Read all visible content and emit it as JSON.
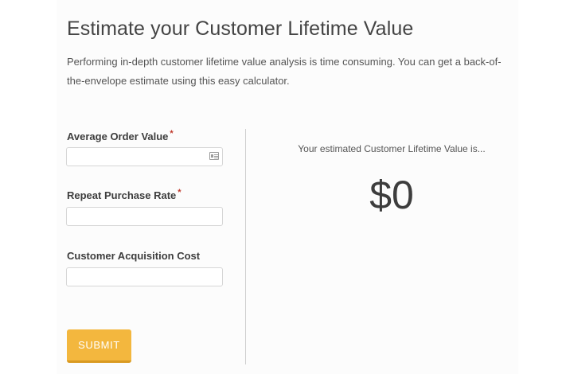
{
  "header": {
    "title": "Estimate your Customer Lifetime Value",
    "intro": "Performing in-depth customer lifetime value analysis is time consuming. You can get a back-of-the-envelope estimate using this easy calculator."
  },
  "form": {
    "fields": [
      {
        "label": "Average Order Value",
        "required": "*",
        "value": "",
        "icon": "contact-card-icon"
      },
      {
        "label": "Repeat Purchase Rate",
        "required": "*",
        "value": ""
      },
      {
        "label": "Customer Acquisition Cost",
        "required": "",
        "value": ""
      }
    ],
    "submit_label": "SUBMIT"
  },
  "result": {
    "label": "Your estimated Customer Lifetime Value is...",
    "value": "$0"
  },
  "colors": {
    "accent": "#f3b73e",
    "required": "#c0392b",
    "text": "#444444"
  }
}
